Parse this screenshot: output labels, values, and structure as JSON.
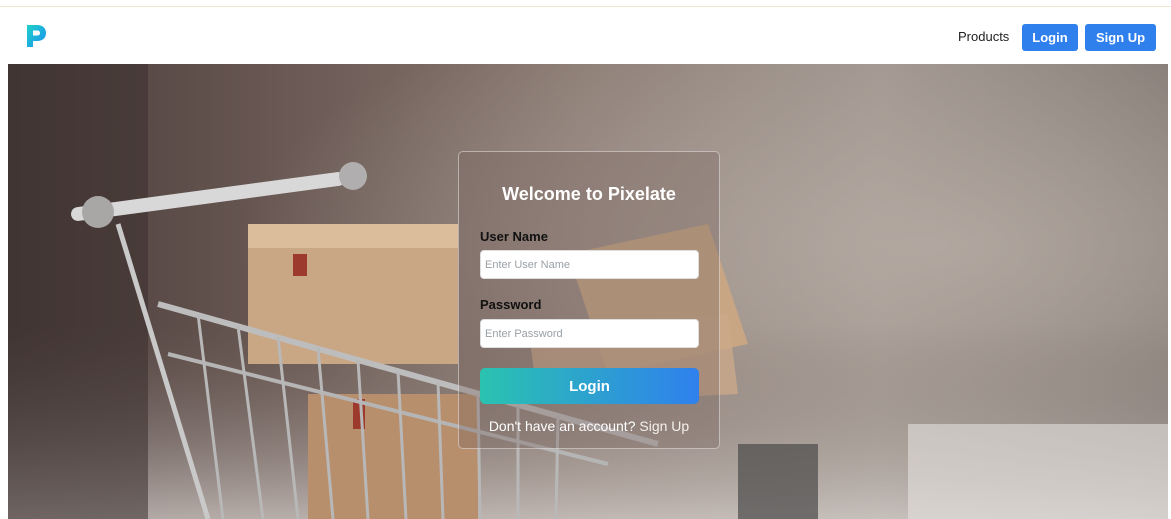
{
  "navbar": {
    "logo_letter": "P",
    "products_label": "Products",
    "login_label": "Login",
    "signup_label": "Sign Up",
    "accent_color": "#2f80ed"
  },
  "login_card": {
    "title": "Welcome to Pixelate",
    "username_label": "User Name",
    "username_placeholder": "Enter User Name",
    "username_value": "",
    "password_label": "Password",
    "password_placeholder": "Enter Password",
    "password_value": "",
    "submit_label": "Login",
    "signup_prompt": "Don't have an account?",
    "signup_link": "Sign Up",
    "button_gradient": [
      "#2ac3b0",
      "#2f80ed"
    ]
  },
  "icons": {
    "logo": "pixelate-p-logo-icon"
  }
}
